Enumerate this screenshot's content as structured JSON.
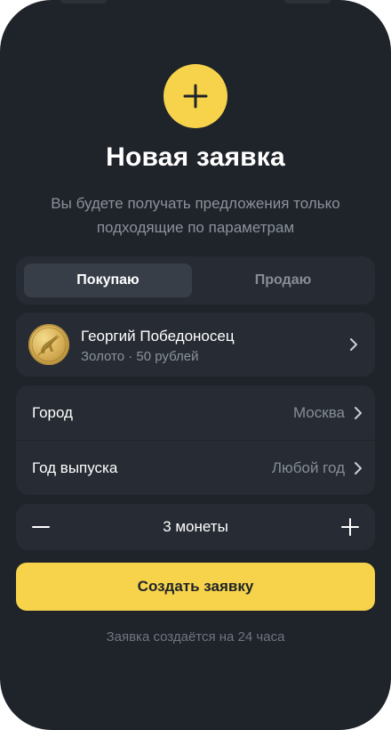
{
  "header": {
    "title": "Новая заявка",
    "subtitle": "Вы будете получать предложения только подходящие по параметрам"
  },
  "segments": {
    "buy_label": "Покупаю",
    "sell_label": "Продаю",
    "selected": "buy"
  },
  "coin": {
    "name": "Георгий Победоносец",
    "details": "Золото · 50 рублей"
  },
  "params": {
    "city_label": "Город",
    "city_value": "Москва",
    "year_label": "Год выпуска",
    "year_value": "Любой год"
  },
  "quantity": {
    "label": "3 монеты",
    "value": 3
  },
  "actions": {
    "create_label": "Создать заявку"
  },
  "footer": {
    "note": "Заявка создаётся на 24 часа"
  },
  "colors": {
    "background": "#1f232a",
    "card": "#272c34",
    "accent": "#f6d34a"
  },
  "icons": [
    "plus-icon",
    "chevron-right-icon",
    "minus-icon",
    "coin-image"
  ]
}
